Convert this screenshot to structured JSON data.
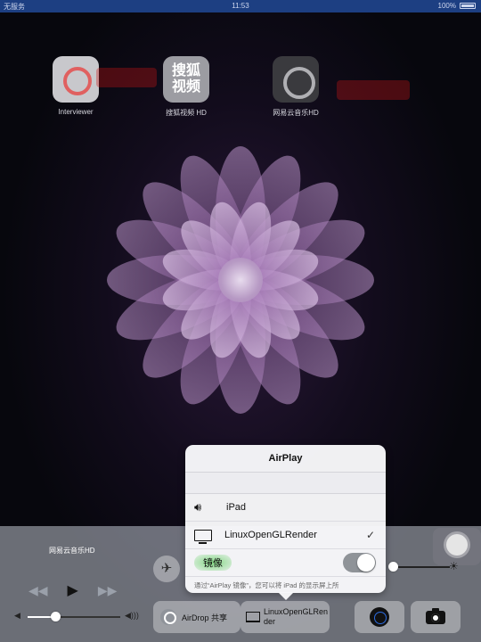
{
  "status_bar": {
    "carrier": "无服务",
    "time": "11:53",
    "battery": "100%"
  },
  "home_apps": [
    {
      "label": "Interviewer",
      "icon": "interviewer-app-icon"
    },
    {
      "label": "搜狐视频 HD",
      "icon": "sohu-video-app-icon",
      "icon_text_1": "搜狐",
      "icon_text_2": "视频"
    },
    {
      "label": "网易云音乐HD",
      "icon": "netease-music-app-icon"
    }
  ],
  "control_center": {
    "now_playing": "网易云音乐HD",
    "transport": {
      "prev": "◀◀",
      "play": "▶",
      "next": "▶▶"
    },
    "airplane_icon": "✈",
    "brightness": {
      "icon": "☀",
      "level": 0.05
    },
    "volume": {
      "icon_low": "◀",
      "icon_high": "◀)))",
      "level": 0.3
    },
    "airdrop_label": "AirDrop 共享",
    "airplay_label": "LinuxOpenGLRender",
    "airplay_label_line1": "LinuxOpenGLRen",
    "airplay_label_line2": "der"
  },
  "airplay_popover": {
    "title": "AirPlay",
    "devices": [
      {
        "label": "iPad",
        "icon": "speaker-icon",
        "selected": false
      },
      {
        "label": "LinuxOpenGLRender",
        "icon": "tv-icon",
        "selected": true
      }
    ],
    "check": "✓",
    "mirroring_label": "镜像",
    "mirroring_on": true,
    "footer": "通过“AirPlay 镜像”，您可以将 iPad 的显示屏上所"
  }
}
